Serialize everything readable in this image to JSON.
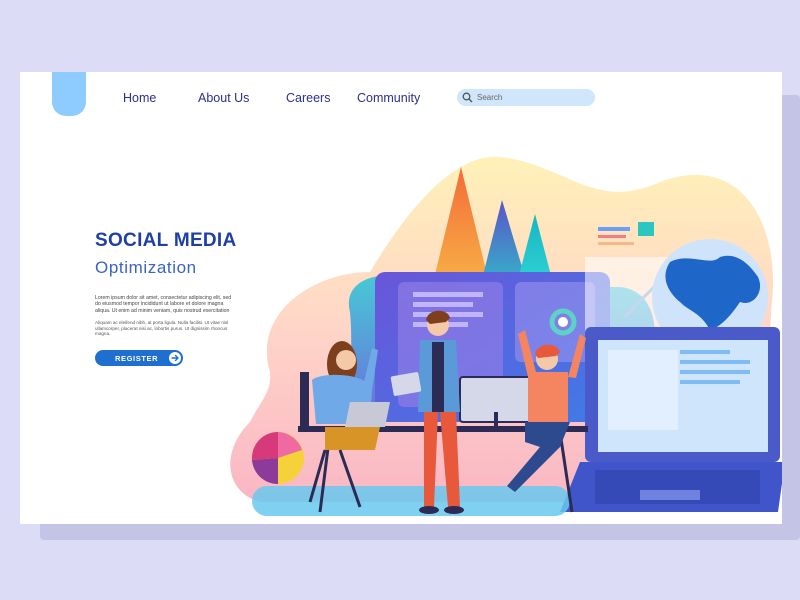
{
  "nav": {
    "items": [
      {
        "label": "Home"
      },
      {
        "label": "About Us"
      },
      {
        "label": "Careers"
      },
      {
        "label": "Community"
      }
    ]
  },
  "search": {
    "placeholder": "Search",
    "value": ""
  },
  "hero": {
    "title": "SOCIAL MEDIA",
    "subtitle": "Optimization",
    "paragraph1": "Lorem ipsum dolor sit amet, consectetur adipiscing elit, sed do eiusmod tempor incididunt ut labore et dolore magna aliqua. Ut enim ad minim veniam, quis nostrud exercitation",
    "paragraph2": "Aliquam ac eleifend nibh, at porta ligula. Nulla facilisi. Ut vitae nisl ullamcorper, placerat nisi ac, lobortis purus. Ut dignissim rhoncus magna.",
    "register_label": "REGISTER"
  },
  "colors": {
    "background": "#dcdcf7",
    "logo": "#8ecbff",
    "nav_text": "#2a2f8f",
    "title": "#1e3fa6",
    "subtitle": "#3b63c7",
    "button": "#1f6fd1"
  },
  "icons": [
    "search-icon",
    "arrow-right-icon",
    "globe-icon",
    "laptop-icon",
    "pie-chart-icon",
    "bar-chart-icon"
  ]
}
